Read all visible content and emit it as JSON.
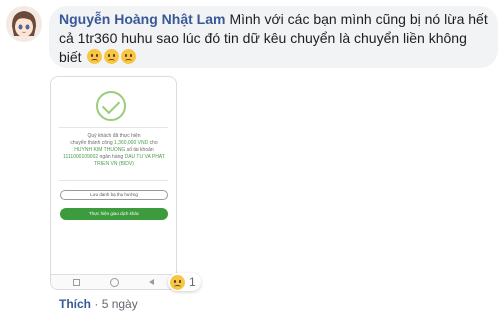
{
  "comment": {
    "author": "Nguyễn Hoàng Nhật Lam",
    "text": "Mình với các bạn mình cũng bị nó lừa hết cả 1tr360 huhu sao lúc đó tin dữ kêu chuyển là chuyển liền không biết",
    "emojis": [
      "sad-face-emoji",
      "crying-face-emoji",
      "crying-face-emoji"
    ]
  },
  "attachment": {
    "message_line1": "Quý khách đã thực hiện",
    "message_line2_prefix": "chuyển thành công",
    "amount": "1,360,000 VND",
    "message_line2_suffix": "cho",
    "recipient": "HUYNH KIM THUONG",
    "account_label": "số tài khoản",
    "account_number": "1111000109002",
    "bank_label": "ngân hàng",
    "bank_name": "DAU TU VA PHAT TRIEN VN (BIDV)",
    "save_button": "Lưu danh bạ thụ hưởng",
    "new_transaction_button": "Thực hiện giao dịch khác"
  },
  "reaction": {
    "icon": "sad-face-emoji",
    "count": "1"
  },
  "actions": {
    "like": "Thích",
    "separator": "·",
    "time": "5 ngày"
  },
  "colors": {
    "author": "#385898",
    "bubble": "#f2f3f5",
    "success_green": "#3c9b3c",
    "check_green": "#9ccc78"
  }
}
